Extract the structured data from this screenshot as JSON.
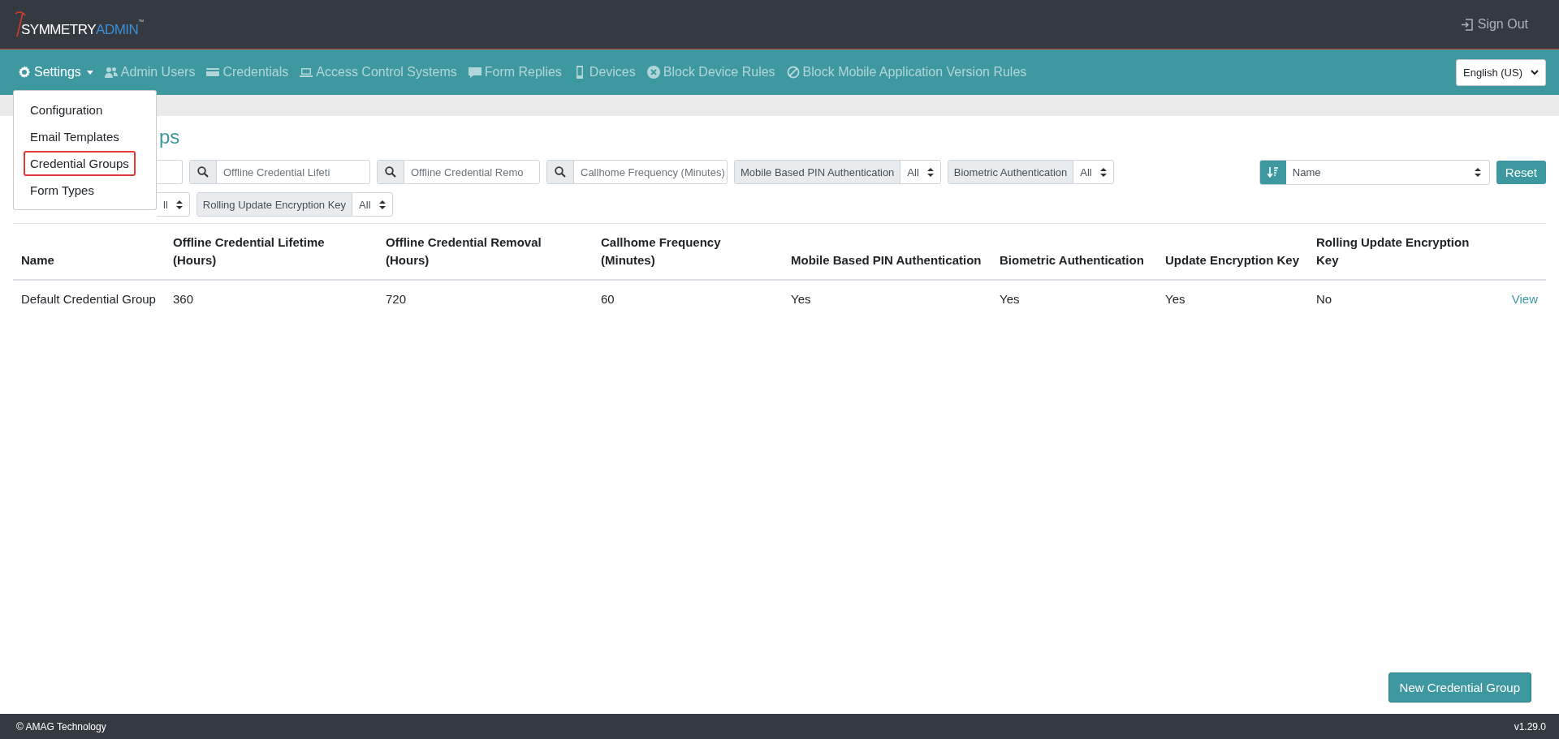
{
  "header": {
    "logo_main": "SYMMETRY",
    "logo_accent": "ADMIN",
    "logo_mark": "™",
    "sign_out": "Sign Out"
  },
  "nav": {
    "items": [
      {
        "label": "Settings",
        "kind": "dropdown",
        "active": true
      },
      {
        "label": "Admin Users",
        "kind": "users",
        "active": false
      },
      {
        "label": "Credentials",
        "kind": "credentials",
        "active": false
      },
      {
        "label": "Access Control Systems",
        "kind": "systems",
        "active": false
      },
      {
        "label": "Form Replies",
        "kind": "replies",
        "active": false
      },
      {
        "label": "Devices",
        "kind": "devices",
        "active": false
      },
      {
        "label": "Block Device Rules",
        "kind": "block",
        "active": false
      },
      {
        "label": "Block Mobile Application Version Rules",
        "kind": "version",
        "active": false
      }
    ],
    "language": "English (US)"
  },
  "settings_menu": [
    {
      "label": "Configuration",
      "selected": false
    },
    {
      "label": "Email Templates",
      "selected": false
    },
    {
      "label": "Credential Groups",
      "selected": true
    },
    {
      "label": "Form Types",
      "selected": false
    }
  ],
  "page_title": "ps",
  "filter_rows": [
    [
      {
        "kind": "input"
      },
      {
        "kind": "search",
        "placeholder": "Offline Credential Lifeti"
      },
      {
        "kind": "search",
        "placeholder": "Offline Credential Remo"
      },
      {
        "kind": "search",
        "placeholder": "Callhome Frequency (Minutes)"
      },
      {
        "kind": "select",
        "label": "Mobile Based PIN Authentication",
        "value": "All"
      },
      {
        "kind": "select",
        "label": "Biometric Authentication",
        "value": "All"
      }
    ],
    [
      {
        "kind": "select",
        "value": "ll"
      },
      {
        "kind": "select",
        "label": "Rolling Update Encryption Key",
        "value": "All"
      }
    ]
  ],
  "sort": {
    "value": "Name",
    "reset": "Reset"
  },
  "table": {
    "columns": [
      "Name",
      "Offline Credential Lifetime (Hours)",
      "Offline Credential Removal (Hours)",
      "Callhome Frequency (Minutes)",
      "Mobile Based PIN Authentication",
      "Biometric Authentication",
      "Update Encryption Key",
      "Rolling Update Encryption Key"
    ],
    "rows": [
      {
        "cells": [
          "Default Credential Group",
          "360",
          "720",
          "60",
          "Yes",
          "Yes",
          "Yes",
          "No"
        ],
        "action": "View"
      }
    ]
  },
  "new_button": "New Credential Group",
  "footer": {
    "copyright": "© AMAG Technology",
    "version": "v1.29.0"
  }
}
